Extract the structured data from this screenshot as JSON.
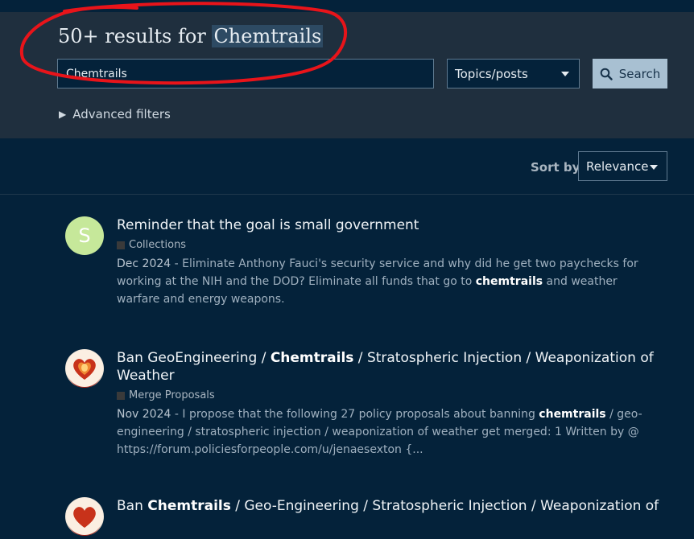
{
  "header": {
    "results_prefix": "50+ results for ",
    "search_term": "Chemtrails",
    "search_value": "Chemtrails",
    "type_selected": "Topics/posts",
    "search_button": "Search",
    "advanced_filters": "Advanced filters"
  },
  "sort": {
    "label": "Sort by",
    "selected": "Relevance"
  },
  "results": [
    {
      "avatar_letter": "S",
      "title": "Reminder that the goal is small government",
      "category": "Collections",
      "date": "Dec 2024",
      "blurb_pre": " - Eliminate Anthony Fauci's security service and why did he get two paychecks for working at the NIH and the DOD? Eliminate all funds that go to ",
      "blurb_hl": "chemtrails",
      "blurb_post": " and weather warfare and energy weapons."
    },
    {
      "title_pre": "Ban GeoEngineering / ",
      "title_hl": "Chemtrails",
      "title_post": " / Stratospheric Injection / Weaponization of Weather",
      "category": "Merge Proposals",
      "date": "Nov 2024",
      "blurb_pre": " - I propose that the following 27 policy proposals about banning ",
      "blurb_hl": "chemtrails",
      "blurb_post": " / geo-engineering / stratospheric injection / weaponization of weather get merged: 1 Written by @ https://forum.policiesforpeople.com/u/jenaesexton {..."
    },
    {
      "title_pre": "Ban ",
      "title_hl": "Chemtrails",
      "title_post": " / Geo-Engineering / Stratospheric Injection / Weaponization of"
    }
  ],
  "colors": {
    "background": "#04223a",
    "header_band": "#1f2f3e",
    "button": "#a8c0d2",
    "annotation": "#e8141a"
  }
}
